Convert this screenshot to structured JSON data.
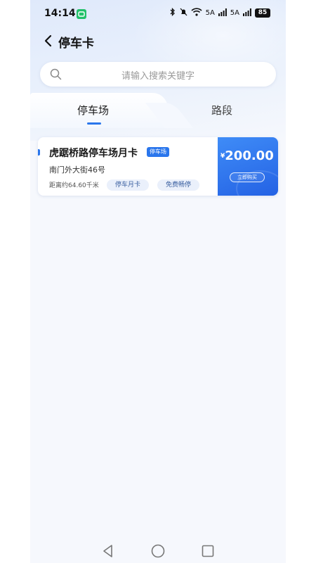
{
  "status_bar": {
    "time": "14:14",
    "app_badge_icon": "messaging-app-icon",
    "network_1": "5A",
    "network_2": "5A",
    "battery": "85"
  },
  "header": {
    "back_icon": "chevron-left-icon",
    "title": "停车卡"
  },
  "search": {
    "placeholder": "请输入搜索关键字",
    "icon": "search-icon"
  },
  "tabs": [
    {
      "label": "停车场",
      "active": true
    },
    {
      "label": "路段",
      "active": false
    }
  ],
  "cards": [
    {
      "title": "虎踞桥路停车场月卡",
      "tag": "停车场",
      "address": "南门外大街46号",
      "distance": "距离约64.60千米",
      "chips": [
        "停车月卡",
        "免费畅停"
      ],
      "currency": "¥",
      "price": "200.00",
      "buy_label": "立即购买"
    }
  ],
  "nav": {
    "back_icon": "triangle-back-icon",
    "home_icon": "circle-home-icon",
    "recent_icon": "square-recent-icon"
  },
  "colors": {
    "accent": "#2a76ec",
    "price_panel": "#2e6ef0",
    "background": "#f6f8fd"
  }
}
